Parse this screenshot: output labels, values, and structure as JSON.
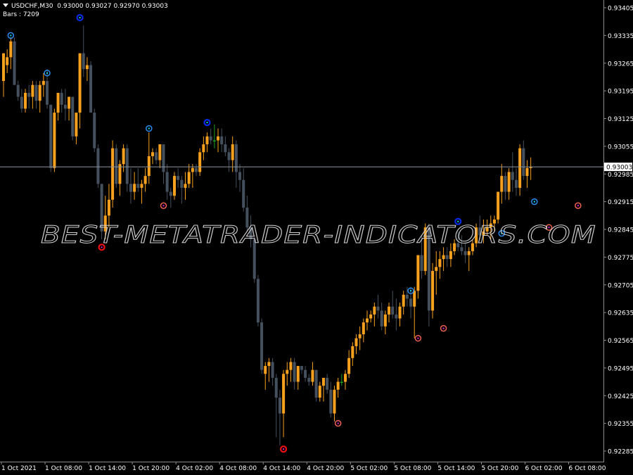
{
  "header": {
    "symbol_line": "USDCHF,M30",
    "ohlc": [
      "0.93000",
      "0.93027",
      "0.92970",
      "0.93003"
    ],
    "bars_label": "Bars : 7209"
  },
  "watermark": "BEST-METATRADER-INDICATORS.COM",
  "colors": {
    "background": "#000000",
    "bull": "#F7A11E",
    "bear": "#45505F",
    "doji": "#1FA01F",
    "grid_axis": "#8C8C8C",
    "price_line": "#8C96A0",
    "high_dot": "#00E5E5",
    "low_dot": "#E020E0",
    "ring_high_strong": "#0A2AE8",
    "ring_high": "#2A8CF0",
    "ring_low_strong": "#F01010",
    "ring_low": "#F06050"
  },
  "chart_data": {
    "type": "candlestick",
    "title": "USDCHF,M30",
    "current_price": 0.93003,
    "ylim": [
      0.9225,
      0.9343
    ],
    "y_ticks": [
      "0.93405",
      "0.93335",
      "0.93265",
      "0.93195",
      "0.93125",
      "0.93055",
      "0.92985",
      "0.92915",
      "0.92845",
      "0.92775",
      "0.92705",
      "0.92635",
      "0.92565",
      "0.92495",
      "0.92425",
      "0.92355",
      "0.92285"
    ],
    "x_ticks": [
      {
        "bar": 0,
        "label": "1 Oct 2021"
      },
      {
        "bar": 12,
        "label": "1 Oct 08:00"
      },
      {
        "bar": 24,
        "label": "1 Oct 14:00"
      },
      {
        "bar": 36,
        "label": "1 Oct 20:00"
      },
      {
        "bar": 48,
        "label": "4 Oct 02:00"
      },
      {
        "bar": 60,
        "label": "4 Oct 08:00"
      },
      {
        "bar": 72,
        "label": "4 Oct 14:00"
      },
      {
        "bar": 84,
        "label": "4 Oct 20:00"
      },
      {
        "bar": 96,
        "label": "5 Oct 02:00"
      },
      {
        "bar": 108,
        "label": "5 Oct 08:00"
      },
      {
        "bar": 120,
        "label": "5 Oct 14:00"
      },
      {
        "bar": 132,
        "label": "5 Oct 20:00"
      },
      {
        "bar": 144,
        "label": "6 Oct 02:00"
      },
      {
        "bar": 156,
        "label": "6 Oct 08:00"
      }
    ],
    "candles": [
      [
        0.9322,
        0.9329,
        0.9318,
        0.9329
      ],
      [
        0.9326,
        0.933,
        0.9324,
        0.9328
      ],
      [
        0.9328,
        0.9333,
        0.9325,
        0.9332
      ],
      [
        0.9332,
        0.9333,
        0.9321,
        0.9321
      ],
      [
        0.9321,
        0.9322,
        0.9317,
        0.9318
      ],
      [
        0.9318,
        0.932,
        0.9314,
        0.9315
      ],
      [
        0.9315,
        0.932,
        0.9314,
        0.9319
      ],
      [
        0.9319,
        0.9321,
        0.9315,
        0.9318
      ],
      [
        0.9318,
        0.9322,
        0.9315,
        0.9321
      ],
      [
        0.9321,
        0.9322,
        0.9315,
        0.9317
      ],
      [
        0.9317,
        0.9322,
        0.9314,
        0.9321
      ],
      [
        0.9321,
        0.9324,
        0.9318,
        0.9322
      ],
      [
        0.9322,
        0.9325,
        0.9315,
        0.9316
      ],
      [
        0.9316,
        0.9315,
        0.9299,
        0.93
      ],
      [
        0.93,
        0.9315,
        0.9299,
        0.9314
      ],
      [
        0.9314,
        0.9319,
        0.9312,
        0.9319
      ],
      [
        0.9319,
        0.932,
        0.9314,
        0.9316
      ],
      [
        0.9316,
        0.932,
        0.9312,
        0.9315
      ],
      [
        0.9315,
        0.9318,
        0.9312,
        0.9318
      ],
      [
        0.9318,
        0.9318,
        0.9307,
        0.9308
      ],
      [
        0.9308,
        0.9314,
        0.9306,
        0.9314
      ],
      [
        0.9314,
        0.9329,
        0.931,
        0.9329
      ],
      [
        0.9329,
        0.9336,
        0.9323,
        0.9325
      ],
      [
        0.9325,
        0.9328,
        0.9322,
        0.9326
      ],
      [
        0.9326,
        0.9327,
        0.9314,
        0.9314
      ],
      [
        0.9314,
        0.9315,
        0.9304,
        0.9305
      ],
      [
        0.9305,
        0.9306,
        0.9295,
        0.9296
      ],
      [
        0.9296,
        0.9296,
        0.9282,
        0.9284
      ],
      [
        0.9284,
        0.9293,
        0.9282,
        0.9288
      ],
      [
        0.9288,
        0.9296,
        0.9285,
        0.9292
      ],
      [
        0.9292,
        0.9307,
        0.929,
        0.9305
      ],
      [
        0.9305,
        0.9306,
        0.9295,
        0.9296
      ],
      [
        0.9296,
        0.9302,
        0.9293,
        0.9301
      ],
      [
        0.9301,
        0.9306,
        0.9299,
        0.9305
      ],
      [
        0.9305,
        0.9306,
        0.9294,
        0.9296
      ],
      [
        0.9296,
        0.93,
        0.9291,
        0.9294
      ],
      [
        0.9294,
        0.9299,
        0.9292,
        0.9296
      ],
      [
        0.9296,
        0.93,
        0.9294,
        0.9295
      ],
      [
        0.9295,
        0.9297,
        0.9291,
        0.9296
      ],
      [
        0.9296,
        0.93,
        0.9294,
        0.9298
      ],
      [
        0.9298,
        0.9309,
        0.9296,
        0.9303
      ],
      [
        0.9303,
        0.9305,
        0.9301,
        0.9304
      ],
      [
        0.9304,
        0.9305,
        0.9301,
        0.9302
      ],
      [
        0.9302,
        0.9306,
        0.93,
        0.9306
      ],
      [
        0.9306,
        0.9306,
        0.9296,
        0.9299
      ],
      [
        0.9299,
        0.9301,
        0.9292,
        0.9294
      ],
      [
        0.9294,
        0.9295,
        0.929,
        0.9293
      ],
      [
        0.9293,
        0.9299,
        0.9292,
        0.9298
      ],
      [
        0.9298,
        0.93,
        0.9295,
        0.9297
      ],
      [
        0.9297,
        0.9298,
        0.9291,
        0.9295
      ],
      [
        0.9295,
        0.9299,
        0.9292,
        0.9296
      ],
      [
        0.9296,
        0.9301,
        0.9295,
        0.9299
      ],
      [
        0.9299,
        0.9301,
        0.9295,
        0.93
      ],
      [
        0.93,
        0.9301,
        0.9298,
        0.9299
      ],
      [
        0.9299,
        0.9305,
        0.9298,
        0.9304
      ],
      [
        0.9304,
        0.9308,
        0.9302,
        0.9306
      ],
      [
        0.9306,
        0.9309,
        0.9304,
        0.9308
      ],
      [
        0.9308,
        0.931,
        0.9306,
        0.9307
      ],
      [
        0.9307,
        0.9311,
        0.9305,
        0.9307
      ],
      [
        0.9307,
        0.931,
        0.9304,
        0.9308
      ],
      [
        0.9308,
        0.931,
        0.9304,
        0.9306
      ],
      [
        0.9306,
        0.9308,
        0.9303,
        0.9304
      ],
      [
        0.9304,
        0.9305,
        0.9299,
        0.9302
      ],
      [
        0.9302,
        0.9308,
        0.9299,
        0.9306
      ],
      [
        0.9306,
        0.9307,
        0.9295,
        0.9299
      ],
      [
        0.9299,
        0.9301,
        0.9294,
        0.9297
      ],
      [
        0.9297,
        0.93,
        0.9289,
        0.929
      ],
      [
        0.929,
        0.9293,
        0.9284,
        0.9285
      ],
      [
        0.9285,
        0.9288,
        0.928,
        0.9282
      ],
      [
        0.9282,
        0.9283,
        0.9271,
        0.9272
      ],
      [
        0.9272,
        0.9273,
        0.926,
        0.9261
      ],
      [
        0.9261,
        0.9262,
        0.9248,
        0.9249
      ],
      [
        0.9248,
        0.9251,
        0.9244,
        0.925
      ],
      [
        0.925,
        0.9252,
        0.9246,
        0.9251
      ],
      [
        0.9251,
        0.9252,
        0.9245,
        0.9247
      ],
      [
        0.9247,
        0.9248,
        0.9232,
        0.9242
      ],
      [
        0.9242,
        0.9244,
        0.923,
        0.9238
      ],
      [
        0.9238,
        0.9249,
        0.9232,
        0.9248
      ],
      [
        0.9248,
        0.9251,
        0.9245,
        0.9249
      ],
      [
        0.9249,
        0.9252,
        0.9246,
        0.9251
      ],
      [
        0.9251,
        0.9252,
        0.9244,
        0.9246
      ],
      [
        0.9246,
        0.925,
        0.9244,
        0.925
      ],
      [
        0.925,
        0.925,
        0.9248,
        0.9249
      ],
      [
        0.9249,
        0.925,
        0.9246,
        0.9247
      ],
      [
        0.9247,
        0.9248,
        0.9245,
        0.9246
      ],
      [
        0.9246,
        0.9251,
        0.9245,
        0.9249
      ],
      [
        0.9249,
        0.9249,
        0.9241,
        0.9242
      ],
      [
        0.9242,
        0.9246,
        0.9241,
        0.9245
      ],
      [
        0.9245,
        0.9247,
        0.9241,
        0.9247
      ],
      [
        0.9247,
        0.9248,
        0.9243,
        0.9244
      ],
      [
        0.9244,
        0.9246,
        0.9237,
        0.9238
      ],
      [
        0.9238,
        0.9245,
        0.9236,
        0.9244
      ],
      [
        0.9244,
        0.9247,
        0.9242,
        0.9246
      ],
      [
        0.9246,
        0.9248,
        0.9245,
        0.9246
      ],
      [
        0.9246,
        0.9249,
        0.9244,
        0.9248
      ],
      [
        0.9248,
        0.9254,
        0.9247,
        0.9252
      ],
      [
        0.9252,
        0.9256,
        0.925,
        0.9255
      ],
      [
        0.9255,
        0.9258,
        0.9253,
        0.9257
      ],
      [
        0.9257,
        0.926,
        0.9254,
        0.9258
      ],
      [
        0.9258,
        0.9262,
        0.9256,
        0.9261
      ],
      [
        0.9261,
        0.9264,
        0.9259,
        0.9262
      ],
      [
        0.9262,
        0.9264,
        0.9261,
        0.9263
      ],
      [
        0.9263,
        0.9266,
        0.926,
        0.9265
      ],
      [
        0.9265,
        0.9268,
        0.9262,
        0.9264
      ],
      [
        0.9264,
        0.9266,
        0.9259,
        0.926
      ],
      [
        0.926,
        0.9264,
        0.9258,
        0.9263
      ],
      [
        0.9263,
        0.9266,
        0.9261,
        0.9265
      ],
      [
        0.9265,
        0.9269,
        0.9262,
        0.9263
      ],
      [
        0.9263,
        0.9267,
        0.9259,
        0.9262
      ],
      [
        0.9262,
        0.9266,
        0.926,
        0.9265
      ],
      [
        0.9265,
        0.9269,
        0.9263,
        0.9268
      ],
      [
        0.9268,
        0.927,
        0.9265,
        0.9267
      ],
      [
        0.9267,
        0.927,
        0.9262,
        0.9265
      ],
      [
        0.9265,
        0.927,
        0.9257,
        0.9269
      ],
      [
        0.9269,
        0.9278,
        0.9267,
        0.9278
      ],
      [
        0.9278,
        0.9283,
        0.9272,
        0.9274
      ],
      [
        0.9274,
        0.9286,
        0.9273,
        0.9285
      ],
      [
        0.9285,
        0.9286,
        0.926,
        0.9264
      ],
      [
        0.9264,
        0.9276,
        0.9262,
        0.9274
      ],
      [
        0.9274,
        0.9279,
        0.9268,
        0.9275
      ],
      [
        0.9275,
        0.9279,
        0.9272,
        0.9277
      ],
      [
        0.9277,
        0.928,
        0.9274,
        0.9278
      ],
      [
        0.9278,
        0.928,
        0.9275,
        0.9277
      ],
      [
        0.9277,
        0.9281,
        0.9275,
        0.9279
      ],
      [
        0.9279,
        0.9282,
        0.9278,
        0.9281
      ],
      [
        0.9281,
        0.9284,
        0.9279,
        0.928
      ],
      [
        0.928,
        0.9283,
        0.9278,
        0.9279
      ],
      [
        0.9279,
        0.9281,
        0.9276,
        0.9278
      ],
      [
        0.9278,
        0.928,
        0.9274,
        0.9279
      ],
      [
        0.9279,
        0.9282,
        0.9278,
        0.9281
      ],
      [
        0.9281,
        0.9286,
        0.928,
        0.9285
      ],
      [
        0.9285,
        0.9288,
        0.9282,
        0.9283
      ],
      [
        0.9283,
        0.9287,
        0.9281,
        0.9284
      ],
      [
        0.9284,
        0.9287,
        0.9283,
        0.9285
      ],
      [
        0.9285,
        0.9288,
        0.9282,
        0.9286
      ],
      [
        0.9286,
        0.9288,
        0.9284,
        0.9287
      ],
      [
        0.9287,
        0.9294,
        0.9286,
        0.9294
      ],
      [
        0.9294,
        0.9301,
        0.9291,
        0.9298
      ],
      [
        0.9298,
        0.9299,
        0.9292,
        0.9294
      ],
      [
        0.9294,
        0.93,
        0.9292,
        0.9299
      ],
      [
        0.9299,
        0.9304,
        0.9294,
        0.9297
      ],
      [
        0.9297,
        0.93,
        0.9293,
        0.9295
      ],
      [
        0.9295,
        0.9306,
        0.9293,
        0.9305
      ],
      [
        0.9305,
        0.9307,
        0.9297,
        0.9298
      ],
      [
        0.9298,
        0.9302,
        0.9295,
        0.93
      ],
      [
        0.93,
        0.93027,
        0.9297,
        0.93003
      ]
    ],
    "markers": [
      {
        "bar": 2,
        "kind": "ring_high",
        "price": 0.93335
      },
      {
        "bar": 12,
        "kind": "ring_high",
        "price": 0.9324
      },
      {
        "bar": 21,
        "kind": "ring_high_strong",
        "price": 0.9338
      },
      {
        "bar": 27,
        "kind": "ring_low_strong",
        "price": 0.928
      },
      {
        "bar": 40,
        "kind": "ring_high",
        "price": 0.931
      },
      {
        "bar": 44,
        "kind": "ring_low",
        "price": 0.92905
      },
      {
        "bar": 56,
        "kind": "ring_high_strong",
        "price": 0.93115
      },
      {
        "bar": 77,
        "kind": "ring_low_strong",
        "price": 0.9229
      },
      {
        "bar": 92,
        "kind": "ring_low",
        "price": 0.92355
      },
      {
        "bar": 112,
        "kind": "ring_high",
        "price": 0.9269
      },
      {
        "bar": 114,
        "kind": "ring_low",
        "price": 0.9257
      },
      {
        "bar": 121,
        "kind": "ring_low",
        "price": 0.92595
      },
      {
        "bar": 125,
        "kind": "ring_high_strong",
        "price": 0.92865
      },
      {
        "bar": 137,
        "kind": "ring_high",
        "price": 0.92835
      },
      {
        "bar": 146,
        "kind": "ring_high",
        "price": 0.92915
      },
      {
        "bar": 150,
        "kind": "ring_low",
        "price": 0.9285
      },
      {
        "bar": 158,
        "kind": "ring_low",
        "price": 0.92905
      }
    ]
  }
}
